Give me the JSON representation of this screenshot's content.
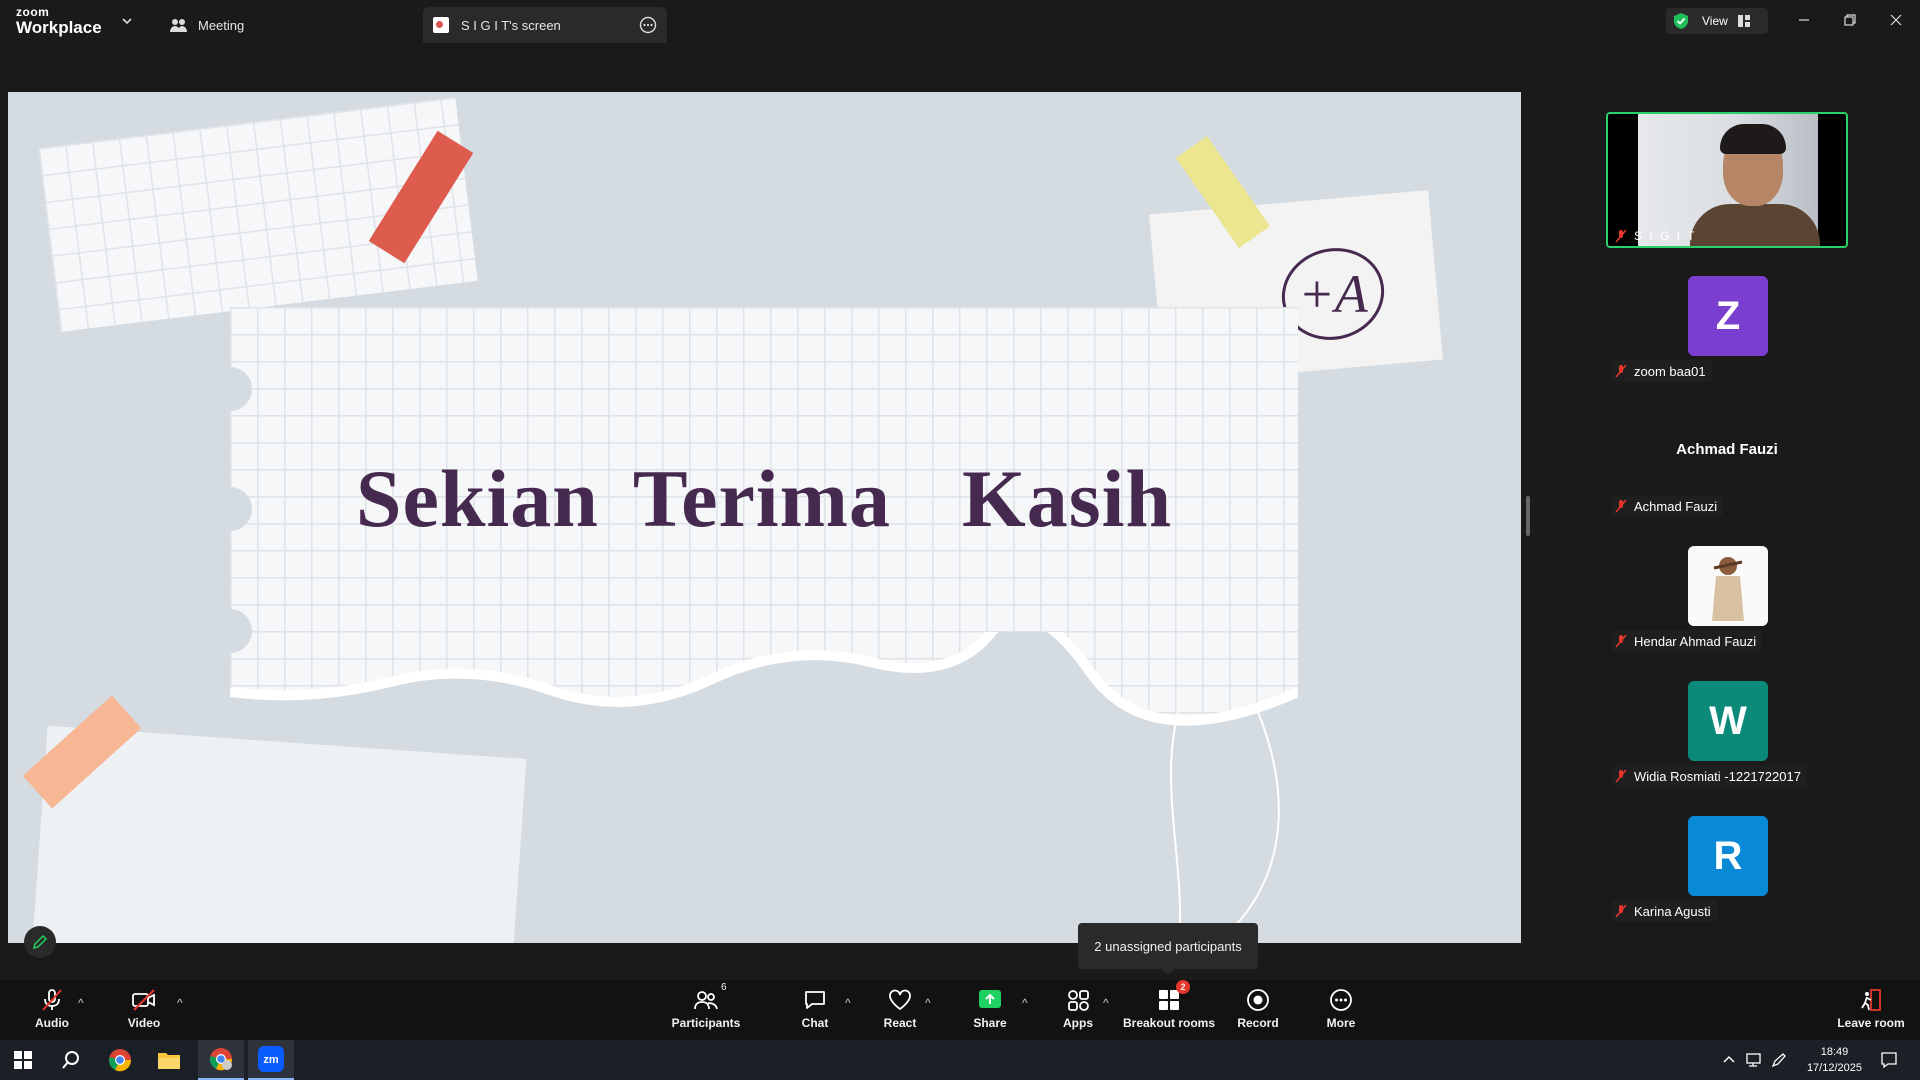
{
  "titlebar": {
    "brand_line1": "zoom",
    "brand_line2": "Workplace",
    "tab_meeting": "Meeting",
    "tab_screen": "S I G I T's screen",
    "view_label": "View"
  },
  "slide": {
    "title": "Sekian Terima  Kasih",
    "grade_mark": "+A"
  },
  "participants": {
    "main_tile_name": "S I G I T",
    "list": [
      {
        "name": "zoom baa01",
        "avatar": "Z",
        "color": "#7a3fcf"
      },
      {
        "name": "Achmad Fauzi",
        "display": "Achmad Fauzi"
      },
      {
        "name": "Hendar Ahmad Fauzi",
        "avatar": "photo"
      },
      {
        "name": "Widia Rosmiati -1221722017",
        "avatar": "W",
        "color": "#0b8a7a"
      },
      {
        "name": "Karina Agusti",
        "avatar": "R",
        "color": "#0a8ad6"
      }
    ]
  },
  "tooltip": "2 unassigned participants",
  "toolbar": {
    "audio": "Audio",
    "video": "Video",
    "participants": "Participants",
    "participants_count": "6",
    "chat": "Chat",
    "react": "React",
    "share": "Share",
    "apps": "Apps",
    "breakout": "Breakout rooms",
    "breakout_badge": "2",
    "record": "Record",
    "more": "More",
    "leave": "Leave room"
  },
  "taskbar": {
    "time": "18:49",
    "date": "17/12/2025"
  },
  "colors": {
    "active_speaker_border": "#2bd16b",
    "muted_red": "#e5372b",
    "share_green": "#1fd160",
    "slide_title": "#46294f"
  }
}
